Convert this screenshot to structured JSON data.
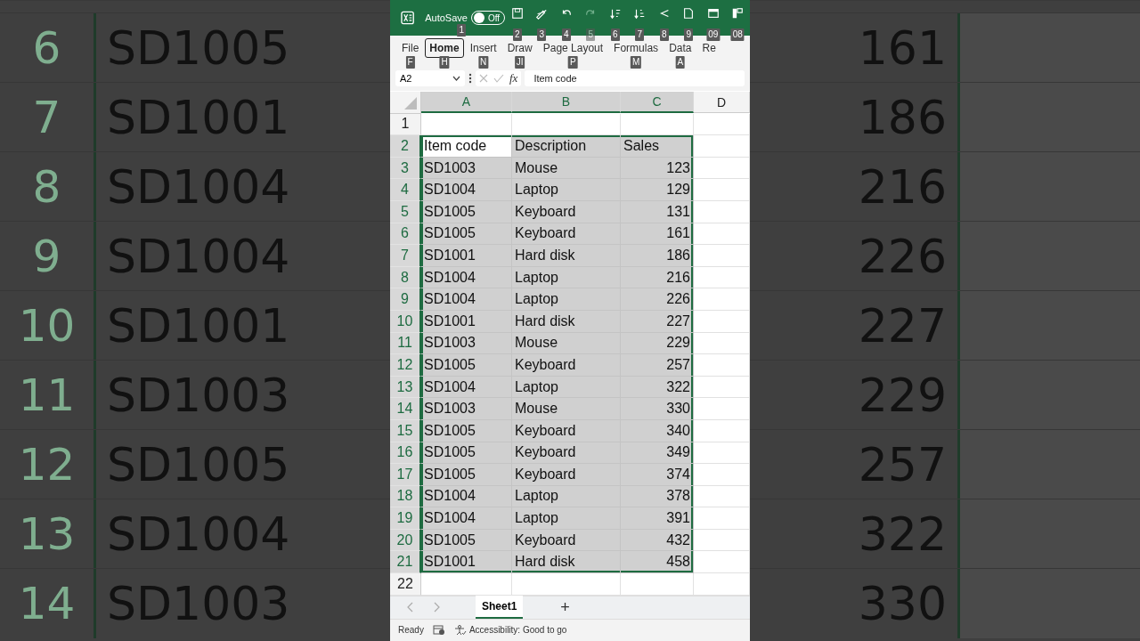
{
  "background_zoom": {
    "left_rows": [
      {
        "row": "6",
        "item_code": "SD1005"
      },
      {
        "row": "7",
        "item_code": "SD1001"
      },
      {
        "row": "8",
        "item_code": "SD1004"
      },
      {
        "row": "9",
        "item_code": "SD1004"
      },
      {
        "row": "10",
        "item_code": "SD1001"
      },
      {
        "row": "11",
        "item_code": "SD1003"
      },
      {
        "row": "12",
        "item_code": "SD1005"
      },
      {
        "row": "13",
        "item_code": "SD1004"
      },
      {
        "row": "14",
        "item_code": "SD1003"
      }
    ],
    "right_rows": [
      "161",
      "186",
      "216",
      "226",
      "227",
      "229",
      "257",
      "322",
      "330"
    ]
  },
  "title_bar": {
    "autosave_label": "AutoSave",
    "autosave_keytip": "1",
    "autosave_toggle": {
      "on": false,
      "label": "Off"
    },
    "quick_access": [
      {
        "kind": "save",
        "keytip": "2",
        "disabled": false
      },
      {
        "kind": "pen",
        "keytip": "3",
        "disabled": false
      },
      {
        "kind": "undo",
        "keytip": "4",
        "disabled": false
      },
      {
        "kind": "redo",
        "keytip": "5",
        "disabled": true
      },
      {
        "kind": "sort-up",
        "keytip": "6",
        "disabled": false
      },
      {
        "kind": "sort-down",
        "keytip": "7",
        "disabled": false
      },
      {
        "kind": "arrow",
        "keytip": "8",
        "disabled": false
      },
      {
        "kind": "doc",
        "keytip": "9",
        "disabled": false
      },
      {
        "kind": "table",
        "keytip": "09",
        "disabled": false
      },
      {
        "kind": "layout",
        "keytip": "08",
        "disabled": false
      }
    ]
  },
  "ribbon_tabs": [
    {
      "label": "File",
      "keytip": "F",
      "selected": false
    },
    {
      "label": "Home",
      "keytip": "H",
      "selected": true
    },
    {
      "label": "Insert",
      "keytip": "N",
      "selected": false
    },
    {
      "label": "Draw",
      "keytip": "JI",
      "selected": false
    },
    {
      "label": "Page Layout",
      "keytip": "P",
      "selected": false
    },
    {
      "label": "Formulas",
      "keytip": "M",
      "selected": false
    },
    {
      "label": "Data",
      "keytip": "A",
      "selected": false
    },
    {
      "label": "Re",
      "selected": false
    }
  ],
  "formula_bar": {
    "name_box": "A2",
    "fx": "fx",
    "content": "Item code"
  },
  "grid": {
    "columns": [
      {
        "label": "A",
        "selected": true
      },
      {
        "label": "B",
        "selected": true
      },
      {
        "label": "C",
        "selected": true
      },
      {
        "label": "D",
        "selected": false
      }
    ],
    "rows": [
      {
        "number": "1",
        "selected": false,
        "cells": []
      },
      {
        "number": "2",
        "selected": true,
        "active": true,
        "cells": [
          "Item code",
          "Description",
          "Sales"
        ]
      },
      {
        "number": "3",
        "selected": true,
        "cells": [
          "SD1003",
          "Mouse",
          "123"
        ]
      },
      {
        "number": "4",
        "selected": true,
        "cells": [
          "SD1004",
          "Laptop",
          "129"
        ]
      },
      {
        "number": "5",
        "selected": true,
        "cells": [
          "SD1005",
          "Keyboard",
          "131"
        ]
      },
      {
        "number": "6",
        "selected": true,
        "cells": [
          "SD1005",
          "Keyboard",
          "161"
        ]
      },
      {
        "number": "7",
        "selected": true,
        "cells": [
          "SD1001",
          "Hard disk",
          "186"
        ]
      },
      {
        "number": "8",
        "selected": true,
        "cells": [
          "SD1004",
          "Laptop",
          "216"
        ]
      },
      {
        "number": "9",
        "selected": true,
        "cells": [
          "SD1004",
          "Laptop",
          "226"
        ]
      },
      {
        "number": "10",
        "selected": true,
        "cells": [
          "SD1001",
          "Hard disk",
          "227"
        ]
      },
      {
        "number": "11",
        "selected": true,
        "cells": [
          "SD1003",
          "Mouse",
          "229"
        ]
      },
      {
        "number": "12",
        "selected": true,
        "cells": [
          "SD1005",
          "Keyboard",
          "257"
        ]
      },
      {
        "number": "13",
        "selected": true,
        "cells": [
          "SD1004",
          "Laptop",
          "322"
        ]
      },
      {
        "number": "14",
        "selected": true,
        "cells": [
          "SD1003",
          "Mouse",
          "330"
        ]
      },
      {
        "number": "15",
        "selected": true,
        "cells": [
          "SD1005",
          "Keyboard",
          "340"
        ]
      },
      {
        "number": "16",
        "selected": true,
        "cells": [
          "SD1005",
          "Keyboard",
          "349"
        ]
      },
      {
        "number": "17",
        "selected": true,
        "cells": [
          "SD1005",
          "Keyboard",
          "374"
        ]
      },
      {
        "number": "18",
        "selected": true,
        "cells": [
          "SD1004",
          "Laptop",
          "378"
        ]
      },
      {
        "number": "19",
        "selected": true,
        "cells": [
          "SD1004",
          "Laptop",
          "391"
        ]
      },
      {
        "number": "20",
        "selected": true,
        "cells": [
          "SD1005",
          "Keyboard",
          "432"
        ]
      },
      {
        "number": "21",
        "selected": true,
        "cells": [
          "SD1001",
          "Hard disk",
          "458"
        ]
      },
      {
        "number": "22",
        "selected": false,
        "cells": []
      }
    ]
  },
  "sheet_tabs": [
    {
      "label": "Sheet1",
      "selected": true
    }
  ],
  "add_sheet": "+",
  "status_bar": {
    "mode": "Ready",
    "accessibility": "Accessibility: Good to go"
  }
}
